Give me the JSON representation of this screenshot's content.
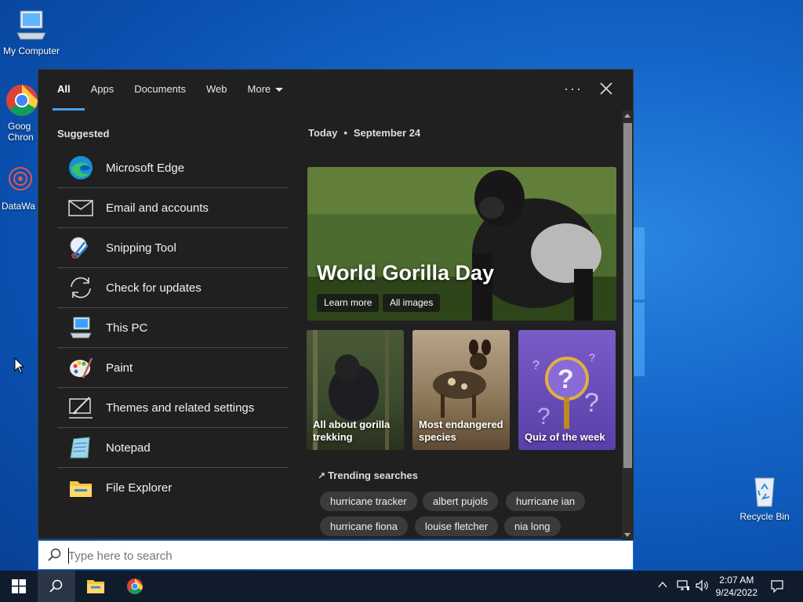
{
  "desktop": {
    "icons": [
      {
        "label": "My Computer"
      },
      {
        "label": "Goog\nChron"
      },
      {
        "label": "DataWa"
      },
      {
        "label": "Recycle Bin"
      }
    ]
  },
  "search_panel": {
    "tabs": [
      {
        "label": "All",
        "active": true
      },
      {
        "label": "Apps"
      },
      {
        "label": "Documents"
      },
      {
        "label": "Web"
      },
      {
        "label": "More"
      }
    ],
    "options_label": "···",
    "suggested": {
      "title": "Suggested",
      "items": [
        {
          "label": "Microsoft Edge",
          "icon": "edge-icon"
        },
        {
          "label": "Email and accounts",
          "icon": "mail-icon"
        },
        {
          "label": "Snipping Tool",
          "icon": "snipping-tool-icon"
        },
        {
          "label": "Check for updates",
          "icon": "sync-icon"
        },
        {
          "label": "This PC",
          "icon": "computer-icon"
        },
        {
          "label": "Paint",
          "icon": "paint-palette-icon"
        },
        {
          "label": "Themes and related settings",
          "icon": "themes-brush-icon"
        },
        {
          "label": "Notepad",
          "icon": "notepad-icon"
        },
        {
          "label": "File Explorer",
          "icon": "folder-icon"
        }
      ]
    },
    "today": {
      "label": "Today",
      "separator": "•",
      "date": "September 24"
    },
    "hero": {
      "title": "World Gorilla Day",
      "buttons": [
        "Learn more",
        "All images"
      ]
    },
    "cards": [
      {
        "caption": "All about gorilla trekking"
      },
      {
        "caption": "Most endangered species"
      },
      {
        "caption": "Quiz of the week"
      }
    ],
    "trending": {
      "title": "Trending searches",
      "chips": [
        "hurricane tracker",
        "albert pujols",
        "hurricane ian",
        "hurricane fiona",
        "louise fletcher",
        "nia long"
      ]
    }
  },
  "searchbox": {
    "placeholder": "Type here to search"
  },
  "taskbar": {
    "clock_time": "2:07 AM",
    "clock_date": "9/24/2022"
  },
  "colors": {
    "accent": "#4aa0f0",
    "panel_bg": "#202020",
    "taskbar_bg": "#101c2c"
  }
}
